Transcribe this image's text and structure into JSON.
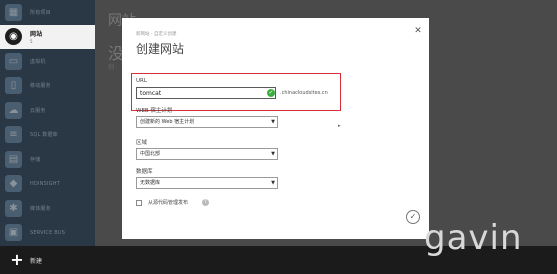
{
  "sidebar": {
    "items": [
      {
        "label": "所有项目",
        "icon": "grid-icon",
        "active": false
      },
      {
        "label": "网站",
        "sub": "5",
        "icon": "globe-icon",
        "active": true
      },
      {
        "label": "虚拟机",
        "icon": "monitor-icon",
        "active": false
      },
      {
        "label": "移动服务",
        "icon": "mobile-icon",
        "active": false
      },
      {
        "label": "云服务",
        "icon": "cloud-icon",
        "active": false
      },
      {
        "label": "SQL 数据库",
        "icon": "database-icon",
        "active": false
      },
      {
        "label": "存储",
        "icon": "table-icon",
        "active": false
      },
      {
        "label": "HDINSIGHT",
        "icon": "elephant-icon",
        "active": false
      },
      {
        "label": "媒体服务",
        "icon": "gear-icon",
        "active": false
      },
      {
        "label": "SERVICE BUS",
        "icon": "bus-icon",
        "active": false
      }
    ]
  },
  "background": {
    "title": "网站",
    "title2": "没",
    "text": "创"
  },
  "bottom_bar": {
    "new_label": "新建"
  },
  "dialog": {
    "breadcrumb": "新网站 - 自定义创建",
    "title": "创建网站",
    "url_label": "URL",
    "url_value": "tomcat",
    "domain_suffix": ".chinacloudsites.cn",
    "plan_label": "WEB 宿主计划",
    "plan_value": "创建新的 Web 宿主计划",
    "region_label": "区域",
    "region_value": "中国北部",
    "db_label": "数据库",
    "db_value": "无数据库",
    "source_control_label": "从源代码管理发布"
  },
  "watermark": "gavin",
  "colors": {
    "highlight": "#d62f3a",
    "valid": "#3cae3f",
    "sidebar": "#2a3846"
  }
}
